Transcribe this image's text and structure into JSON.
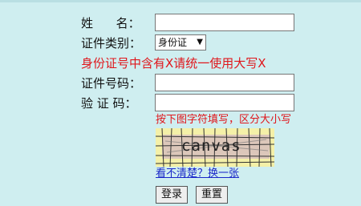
{
  "form": {
    "name_label": "姓      名：",
    "name_value": "",
    "id_type_label": "证件类别：",
    "id_type_selected": "身份证",
    "warning": "身份证号中含有X请统一使用大写X",
    "id_number_label": "证件号码：",
    "id_number_value": "",
    "captcha_label": "验 证 码：",
    "captcha_value": "",
    "captcha_hint": "按下图字符填写，区分大小写",
    "captcha_text": "canvas",
    "refresh_link": "看不清楚？换一张",
    "login_button": "登录",
    "reset_button": "重置"
  },
  "colors": {
    "background": "#cfeef0",
    "warning": "#e0161b",
    "link": "#1a27c9",
    "captcha_bg": "#f4f0a8"
  }
}
